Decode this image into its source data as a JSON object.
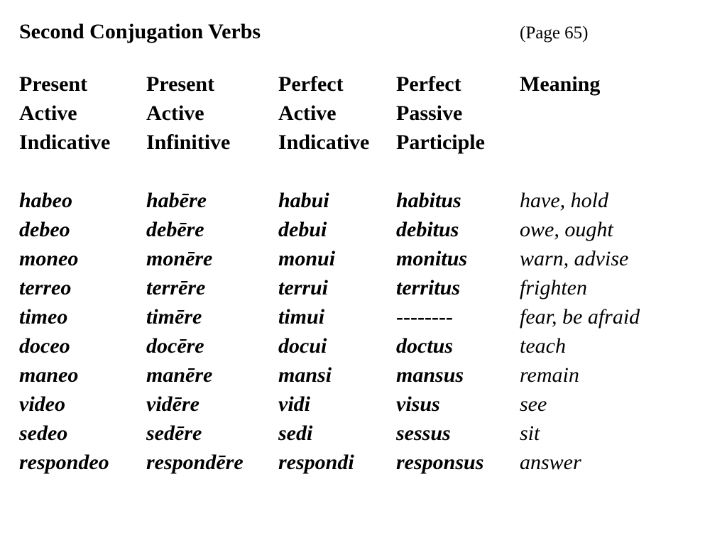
{
  "slide": {
    "title": "Second Conjugation Verbs",
    "page_reference": "(Page 65)"
  },
  "table": {
    "headers": [
      [
        "Present",
        "Active",
        "Indicative"
      ],
      [
        "Present",
        "Active",
        "Infinitive"
      ],
      [
        "Perfect",
        "Active",
        "Indicative"
      ],
      [
        "Perfect",
        "Passive",
        "Participle"
      ],
      [
        "Meaning",
        "",
        ""
      ]
    ],
    "rows": [
      [
        "habeo",
        "habēre",
        "habui",
        "habitus",
        "have, hold"
      ],
      [
        "debeo",
        "debēre",
        "debui",
        "debitus",
        "owe, ought"
      ],
      [
        "moneo",
        "monēre",
        "monui",
        "monitus",
        "warn, advise"
      ],
      [
        "terreo",
        "terrēre",
        "terrui",
        "territus",
        "frighten"
      ],
      [
        "timeo",
        "timēre",
        "timui",
        "--------",
        "fear, be afraid"
      ],
      [
        "doceo",
        "docēre",
        "docui",
        "doctus",
        "teach"
      ],
      [
        "maneo",
        "manēre",
        "mansi",
        "mansus",
        "remain"
      ],
      [
        "video",
        "vidēre",
        "vidi",
        "visus",
        "see"
      ],
      [
        "sedeo",
        "sedēre",
        "sedi",
        "sessus",
        "sit"
      ],
      [
        "respondeo",
        "respondēre",
        "respondi",
        "responsus",
        "answer"
      ]
    ]
  }
}
